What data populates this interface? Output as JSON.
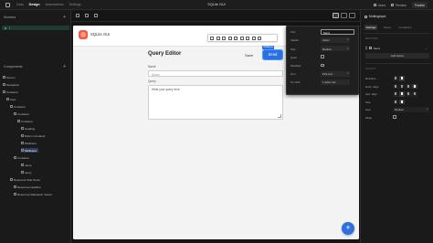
{
  "topbar": {
    "tabs": [
      "Data",
      "Design",
      "Automations",
      "Settings"
    ],
    "active_tab": "Design",
    "app_title": "SQLite GUI",
    "actions": {
      "users": "Users",
      "preview": "Preview",
      "publish": "Publish"
    }
  },
  "left": {
    "screens_label": "Screens",
    "screen_item": "/",
    "components_label": "Components",
    "components": [
      {
        "label": "Screen",
        "depth": 0
      },
      {
        "label": "Navigation",
        "depth": 0
      },
      {
        "label": "Container",
        "depth": 0
      },
      {
        "label": "View",
        "depth": 1
      },
      {
        "label": "Container",
        "depth": 2
      },
      {
        "label": "Container",
        "depth": 3
      },
      {
        "label": "Container",
        "depth": 4
      },
      {
        "label": "Heading",
        "depth": 5
      },
      {
        "label": "Button Container",
        "depth": 5
      },
      {
        "label": "Multiinput",
        "depth": 5
      },
      {
        "label": "Multiinput",
        "depth": 5
      },
      {
        "label": "Container",
        "depth": 3
      },
      {
        "label": "name",
        "depth": 5
      },
      {
        "label": "query",
        "depth": 5
      },
      {
        "label": "Response Side Panel",
        "depth": 2
      },
      {
        "label": "Response headline",
        "depth": 3
      },
      {
        "label": "Response Markdown Viewer",
        "depth": 3
      }
    ],
    "selected_index": 10
  },
  "canvas": {
    "brand": "SQLite GUI",
    "title": "Query Editor",
    "save_label": "Save",
    "send_label": "Send",
    "send_tag": "Multiinput",
    "name_label": "Name",
    "name_placeholder": "Name",
    "query_label": "Query",
    "query_placeholder": "Write your query here",
    "fab": "+"
  },
  "props": {
    "rows": [
      {
        "label": "Text",
        "value": "Send",
        "kind": "text"
      },
      {
        "label": "Variant",
        "value": "Action",
        "kind": "select"
      },
      {
        "label": "Size",
        "value": "Medium",
        "kind": "select"
      },
      {
        "label": "Quiet",
        "kind": "check"
      },
      {
        "label": "Disabled",
        "kind": "check"
      },
      {
        "label": "Icon",
        "value": "Pick icon",
        "kind": "select"
      },
      {
        "label": "On click",
        "value": "1 action set",
        "kind": "field"
      }
    ]
  },
  "right": {
    "title": "Multinginput",
    "tabs": [
      "Settings",
      "Styles",
      "Conditions"
    ],
    "active_tab": "Settings",
    "buttons_section": "BUTTONS",
    "button_item": "Send",
    "add_button": "Add button",
    "layout_section": "LAYOUT",
    "layout_rows": [
      {
        "label": "Direction",
        "kind": "icons",
        "count": 2,
        "active": 1
      },
      {
        "label": "Horiz. align",
        "kind": "icons",
        "count": 4,
        "active": 3
      },
      {
        "label": "Vert. align",
        "kind": "icons",
        "count": 4,
        "active": 1
      },
      {
        "label": "Size",
        "kind": "icons",
        "count": 2,
        "active": 1
      },
      {
        "label": "Gap",
        "kind": "select",
        "value": "Medium"
      },
      {
        "label": "Wrap",
        "kind": "check"
      }
    ]
  }
}
